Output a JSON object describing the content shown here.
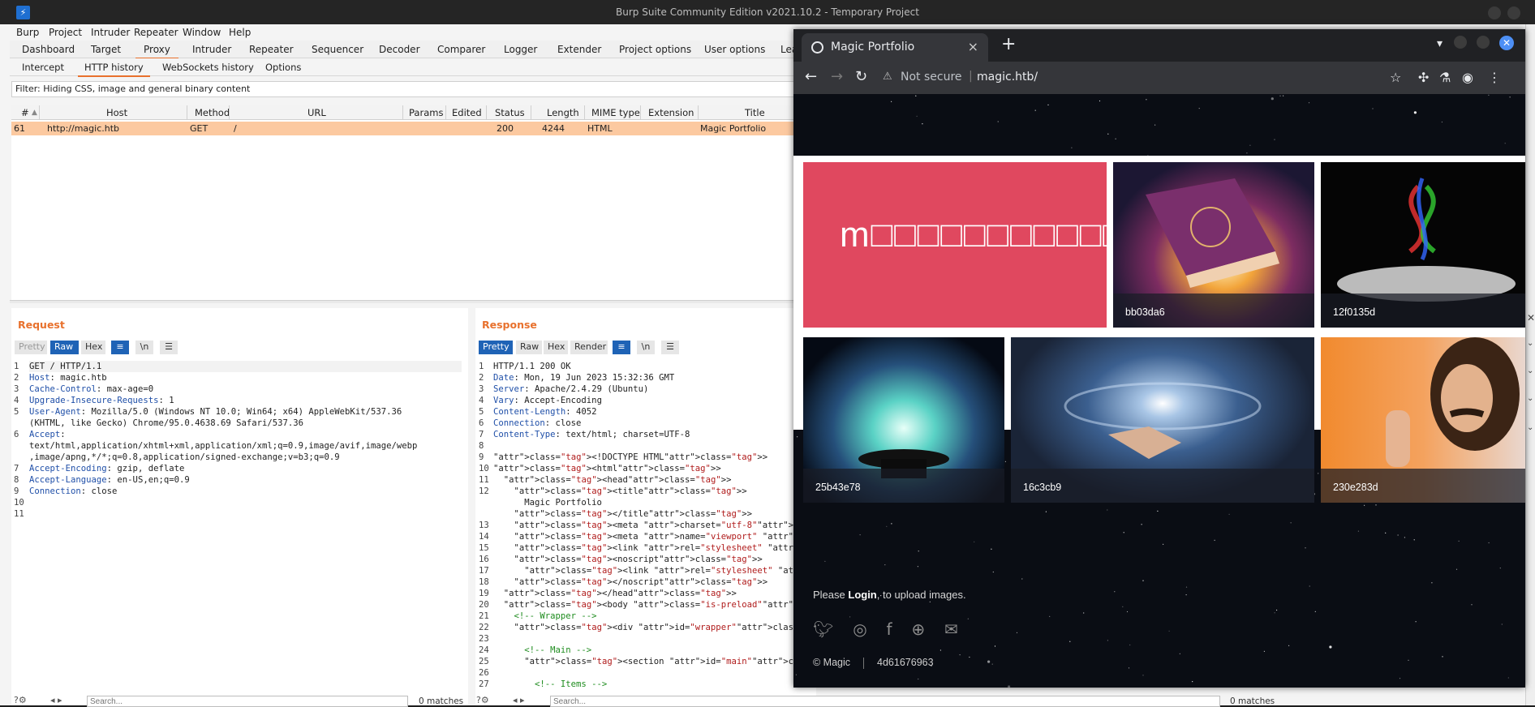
{
  "burp": {
    "title": "Burp Suite Community Edition v2021.10.2 - Temporary Project",
    "menu": [
      "Burp",
      "Project",
      "Intruder",
      "Repeater",
      "Window",
      "Help"
    ],
    "tabs": [
      "Dashboard",
      "Target",
      "Proxy",
      "Intruder",
      "Repeater",
      "Sequencer",
      "Decoder",
      "Comparer",
      "Logger",
      "Extender",
      "Project options",
      "User options",
      "Lea"
    ],
    "active_tab": "Proxy",
    "subtabs": [
      "Intercept",
      "HTTP history",
      "WebSockets history",
      "Options"
    ],
    "active_subtab": "HTTP history",
    "filter": "Filter: Hiding CSS, image and general binary content",
    "columns": [
      "#",
      "Host",
      "Method",
      "URL",
      "Params",
      "Edited",
      "Status",
      "Length",
      "MIME type",
      "Extension",
      "Title"
    ],
    "row": {
      "num": "61",
      "host": "http://magic.htb",
      "method": "GET",
      "url": "/",
      "params": "",
      "edited": "",
      "status": "200",
      "length": "4244",
      "mime": "HTML",
      "extension": "",
      "title": "Magic Portfolio"
    },
    "request": {
      "label": "Request",
      "buttons": [
        "Pretty",
        "Raw",
        "Hex"
      ],
      "selected": "Raw",
      "line_numbers": [
        "1",
        "2",
        "3",
        "4",
        "5",
        "",
        "6",
        "",
        "",
        "7",
        "8",
        "9",
        "10",
        "11"
      ],
      "lines": [
        {
          "k": "GET / HTTP/1.1",
          "v": ""
        },
        {
          "k": "Host",
          "v": ": magic.htb"
        },
        {
          "k": "Cache-Control",
          "v": ": max-age=0"
        },
        {
          "k": "Upgrade-Insecure-Requests",
          "v": ": 1"
        },
        {
          "k": "User-Agent",
          "v": ": Mozilla/5.0 (Windows NT 10.0; Win64; x64) AppleWebKit/537.36"
        },
        {
          "k": "",
          "v": "(KHTML, like Gecko) Chrome/95.0.4638.69 Safari/537.36"
        },
        {
          "k": "Accept",
          "v": ":"
        },
        {
          "k": "",
          "v": "text/html,application/xhtml+xml,application/xml;q=0.9,image/avif,image/webp"
        },
        {
          "k": "",
          "v": ",image/apng,*/*;q=0.8,application/signed-exchange;v=b3;q=0.9"
        },
        {
          "k": "Accept-Encoding",
          "v": ": gzip, deflate"
        },
        {
          "k": "Accept-Language",
          "v": ": en-US,en;q=0.9"
        },
        {
          "k": "Connection",
          "v": ": close"
        },
        {
          "k": "",
          "v": ""
        },
        {
          "k": "",
          "v": ""
        }
      ],
      "search_placeholder": "Search...",
      "matches": "0 matches"
    },
    "response": {
      "label": "Response",
      "buttons": [
        "Pretty",
        "Raw",
        "Hex",
        "Render"
      ],
      "selected": "Pretty",
      "line_numbers": [
        "1",
        "2",
        "3",
        "4",
        "5",
        "6",
        "7",
        "8",
        "9",
        "10",
        "11",
        "12",
        "",
        "",
        "13",
        "14",
        "15",
        "16",
        "17",
        "18",
        "19",
        "20",
        "21",
        "22",
        "23",
        "24",
        "25",
        "26",
        "27"
      ],
      "lines": [
        "HTTP/1.1 200 OK",
        "Date: Mon, 19 Jun 2023 15:32:36 GMT",
        "Server: Apache/2.4.29 (Ubuntu)",
        "Vary: Accept-Encoding",
        "Content-Length: 4052",
        "Connection: close",
        "Content-Type: text/html; charset=UTF-8",
        "",
        "<!DOCTYPE HTML>",
        "<html>",
        "  <head>",
        "    <title>",
        "      Magic Portfolio",
        "    </title>",
        "    <meta charset=\"utf-8\"/>",
        "    <meta name=\"viewport\" content=\"width=device-width",
        "    <link rel=\"stylesheet\" href=\"assets/css/main.css\"",
        "    <noscript>",
        "      <link rel=\"stylesheet\" href=\"assets/css/noscrip",
        "    </noscript>",
        "  </head>",
        "  <body class=\"is-preload\">",
        "    <!-- Wrapper -->",
        "    <div id=\"wrapper\">",
        "",
        "      <!-- Main -->",
        "      <section id=\"main\">",
        "",
        "        <!-- Items -->"
      ],
      "search_placeholder": "Search...",
      "matches": "0 matches"
    }
  },
  "browser": {
    "tab_title": "Magic Portfolio",
    "security": "Not secure",
    "url": "magic.htb/",
    "brand": "m□□□□□□□□□□□□",
    "tiles": [
      "bb03da6",
      "12f0135d",
      "25b43e78",
      "16c3cb9",
      "230e283d"
    ],
    "footer_prefix": "Please ",
    "footer_login": "Login",
    "footer_suffix": ", to upload images.",
    "social_icons": [
      "twitter-icon",
      "instagram-icon",
      "facebook-icon",
      "dribbble-icon",
      "envelope-icon"
    ],
    "copyright": "© Magic",
    "hash": "4d61676963"
  },
  "colors": {
    "burp_orange": "#e8712d",
    "selected_row": "#fcc9a0",
    "brand_tile": "#e0485f",
    "button_blue": "#1f63b6"
  }
}
